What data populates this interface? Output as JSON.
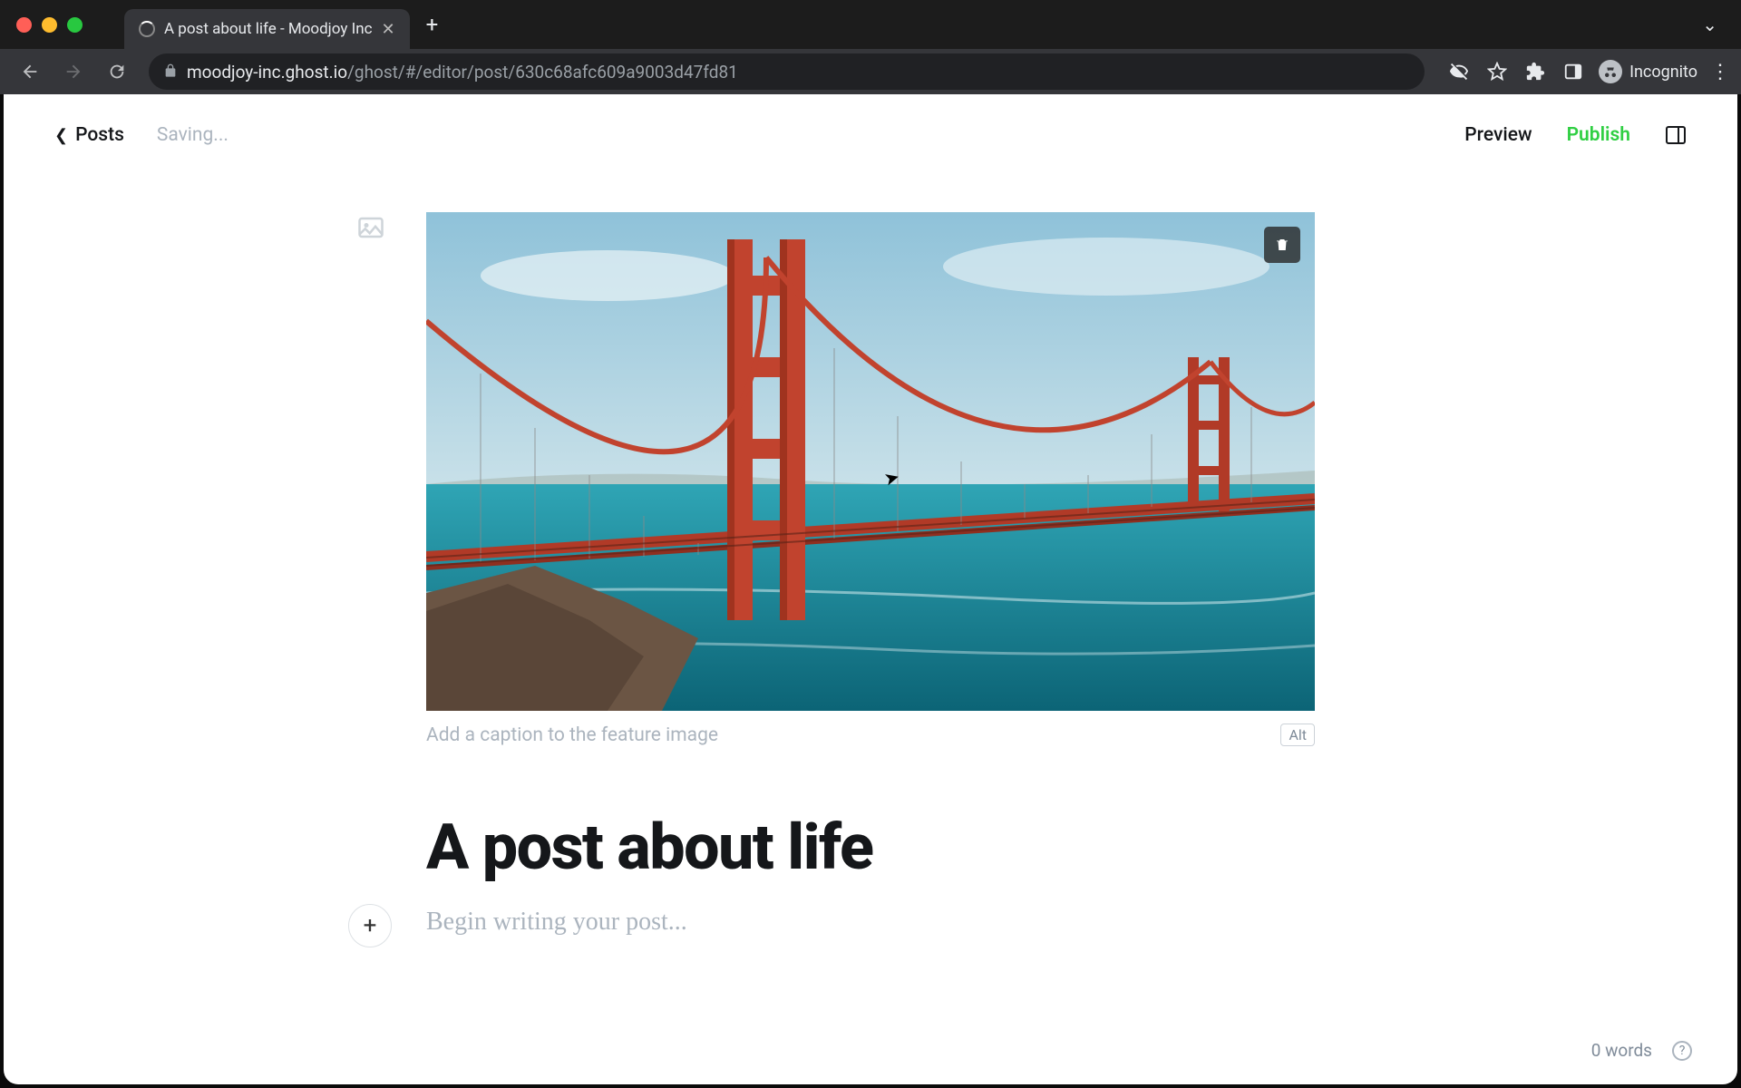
{
  "browser": {
    "tab_title": "A post about life - Moodjoy Inc",
    "url_domain": "moodjoy-inc.ghost.io",
    "url_path": "/ghost/#/editor/post/630c68afc609a9003d47fd81",
    "incognito_label": "Incognito"
  },
  "header": {
    "back_label": "Posts",
    "status": "Saving...",
    "preview": "Preview",
    "publish": "Publish"
  },
  "editor": {
    "caption_placeholder": "Add a caption to the feature image",
    "alt_label": "Alt",
    "title": "A post about life",
    "body_placeholder": "Begin writing your post..."
  },
  "footer": {
    "word_count": "0 words"
  },
  "colors": {
    "publish_green": "#30cf43",
    "bridge_red": "#c1432e",
    "sky_top": "#a7cfe0",
    "sky_bottom": "#d8ebf0",
    "water": "#1a8da1",
    "water_deep": "#0e6b7d",
    "hills": "#a8b8b0",
    "rock": "#6b5544"
  }
}
